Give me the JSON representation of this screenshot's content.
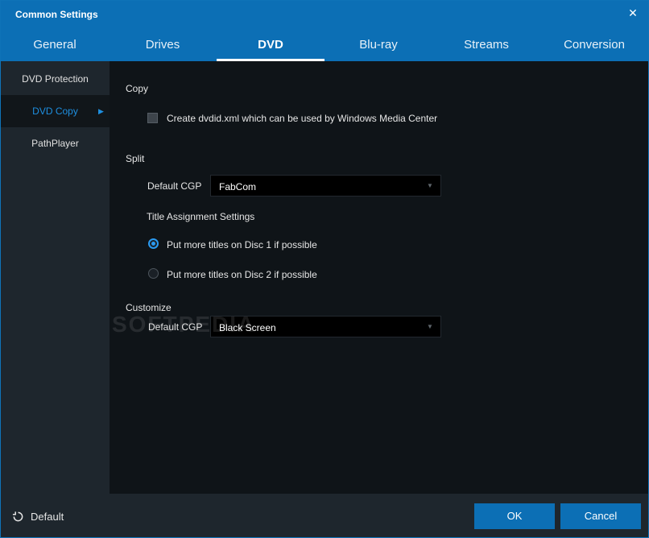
{
  "window": {
    "title": "Common Settings"
  },
  "tabs": [
    {
      "label": "General"
    },
    {
      "label": "Drives"
    },
    {
      "label": "DVD"
    },
    {
      "label": "Blu-ray"
    },
    {
      "label": "Streams"
    },
    {
      "label": "Conversion"
    }
  ],
  "active_tab": "DVD",
  "sidebar": {
    "items": [
      {
        "label": "DVD Protection"
      },
      {
        "label": "DVD Copy"
      },
      {
        "label": "PathPlayer"
      }
    ],
    "active": "DVD Copy"
  },
  "copy": {
    "title": "Copy",
    "checkbox_label": "Create dvdid.xml which can be used by Windows Media Center",
    "checked": false
  },
  "split": {
    "title": "Split",
    "cgp_label": "Default CGP",
    "cgp_value": "FabCom",
    "title_assignment_label": "Title Assignment Settings",
    "radio1_label": "Put more titles on Disc 1 if possible",
    "radio2_label": "Put more titles on Disc 2 if possible",
    "selected": "Put more titles on Disc 1 if possible"
  },
  "customize": {
    "title": "Customize",
    "cgp_label": "Default CGP",
    "cgp_value": "Black Screen"
  },
  "watermark": "SOFTPEDIA",
  "footer": {
    "default_label": "Default",
    "ok_label": "OK",
    "cancel_label": "Cancel"
  },
  "colors": {
    "accent": "#0c6fb5",
    "highlight": "#1e8fe0",
    "background": "#0f1418",
    "sidebar": "#1e262d"
  }
}
